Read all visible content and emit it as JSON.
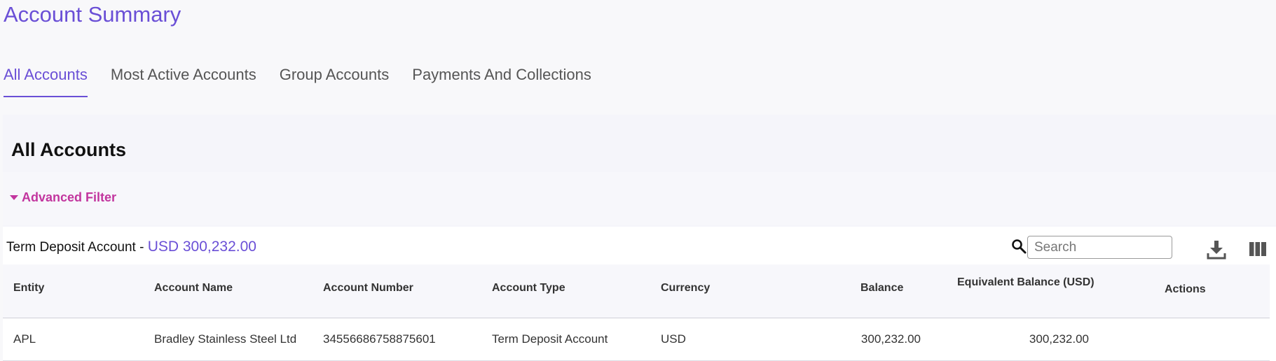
{
  "page_title": "Account Summary",
  "tabs": [
    {
      "label": "All Accounts",
      "active": true
    },
    {
      "label": "Most Active Accounts",
      "active": false
    },
    {
      "label": "Group Accounts",
      "active": false
    },
    {
      "label": "Payments And Collections",
      "active": false
    }
  ],
  "section": {
    "title": "All Accounts",
    "advanced_filter": "Advanced Filter"
  },
  "summary": {
    "account_type": "Term Deposit Account - ",
    "total": "USD 300,232.00"
  },
  "search": {
    "placeholder": "Search"
  },
  "icons": {
    "search": "search-icon",
    "download": "download-icon",
    "columns": "columns-icon"
  },
  "colors": {
    "accent": "#6a4fd6",
    "filter": "#c2359e"
  },
  "table": {
    "headers": [
      "Entity",
      "Account Name",
      "Account Number",
      "Account Type",
      "Currency",
      "Balance",
      "Equivalent Balance (USD)",
      "Actions"
    ],
    "rows": [
      [
        "APL",
        "Bradley Stainless Steel Ltd",
        "34556686758875601",
        "Term Deposit Account",
        "USD",
        "300,232.00",
        "300,232.00",
        ""
      ]
    ]
  }
}
